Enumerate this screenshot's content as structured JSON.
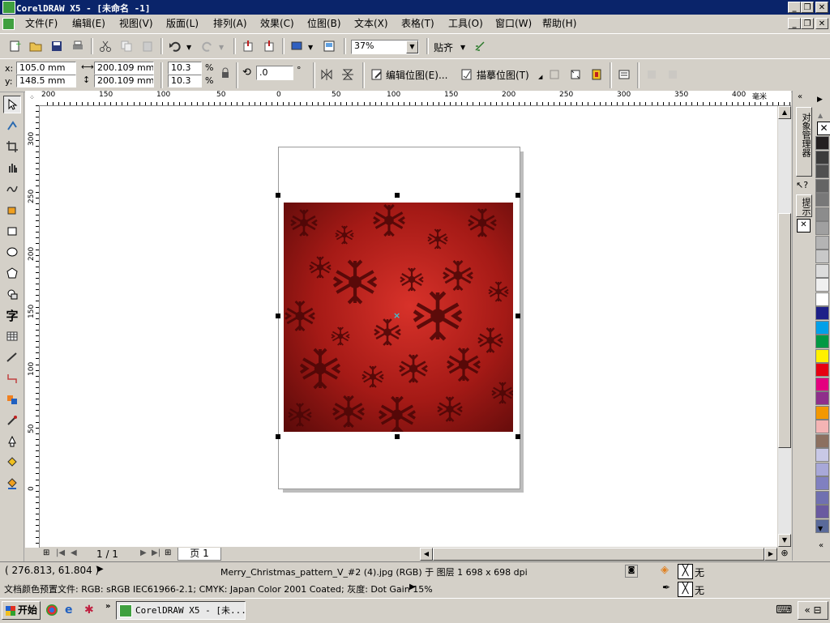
{
  "window": {
    "title": "CorelDRAW X5 - [未命名 -1]",
    "min_glyph": "_",
    "max_glyph": "❐",
    "close_glyph": "✕"
  },
  "menu": [
    "文件(F)",
    "编辑(E)",
    "视图(V)",
    "版面(L)",
    "排列(A)",
    "效果(C)",
    "位图(B)",
    "文本(X)",
    "表格(T)",
    "工具(O)",
    "窗口(W)",
    "帮助(H)"
  ],
  "standard_toolbar": {
    "zoom": "37%",
    "snap_label": "贴齐"
  },
  "property_bar": {
    "x_label": "x:",
    "x_value": "105.0 mm",
    "y_label": "y:",
    "y_value": "148.5 mm",
    "width_value": "200.109 mm",
    "height_value": "200.109 mm",
    "scale_x": "10.3",
    "scale_y": "10.3",
    "percent": "%",
    "rotation": ".0",
    "degree": "°",
    "edit_bitmap": "编辑位图(E)...",
    "trace_bitmap": "描摹位图(T)"
  },
  "rulers": {
    "unit": "毫米",
    "h_labels": [
      "200",
      "150",
      "100",
      "50",
      "0",
      "50",
      "100",
      "150",
      "200",
      "250",
      "300",
      "350",
      "400"
    ],
    "v_labels": [
      "300",
      "250",
      "200",
      "150",
      "100",
      "50",
      "0"
    ]
  },
  "docker": {
    "tab1": "对象管理器",
    "tab2": "提示"
  },
  "palette_colors": [
    "#231f20",
    "#3c3c3c",
    "#505050",
    "#646464",
    "#787878",
    "#8c8c8c",
    "#a0a0a0",
    "#b4b4b4",
    "#c8c8c8",
    "#dcdcdc",
    "#f0f0f0",
    "#ffffff",
    "#1d2088",
    "#00a0e9",
    "#009944",
    "#fff100",
    "#e60012",
    "#e4007f",
    "#8f2f8b",
    "#f39800",
    "#f4b4b4",
    "#8c7060",
    "#c8c8e6",
    "#a8a8d8",
    "#8080c0",
    "#7070b0",
    "#6a5aa0",
    "#5a6a9a"
  ],
  "page_navigator": {
    "count": "1 / 1",
    "tab": "页 1"
  },
  "status": {
    "coords": "( 276.813, 61.804 )",
    "object_info": "Merry_Christmas_pattern_V_#2 (4).jpg (RGB) 于 图层 1 698 x 698 dpi",
    "color_profile": "文档颜色预置文件: RGB: sRGB IEC61966-2.1; CMYK: Japan Color 2001 Coated; 灰度: Dot Gain 15%",
    "fill_label": "无",
    "outline_label": "无"
  },
  "taskbar": {
    "start": "开始",
    "task": "CorelDRAW X5 - [未..."
  }
}
